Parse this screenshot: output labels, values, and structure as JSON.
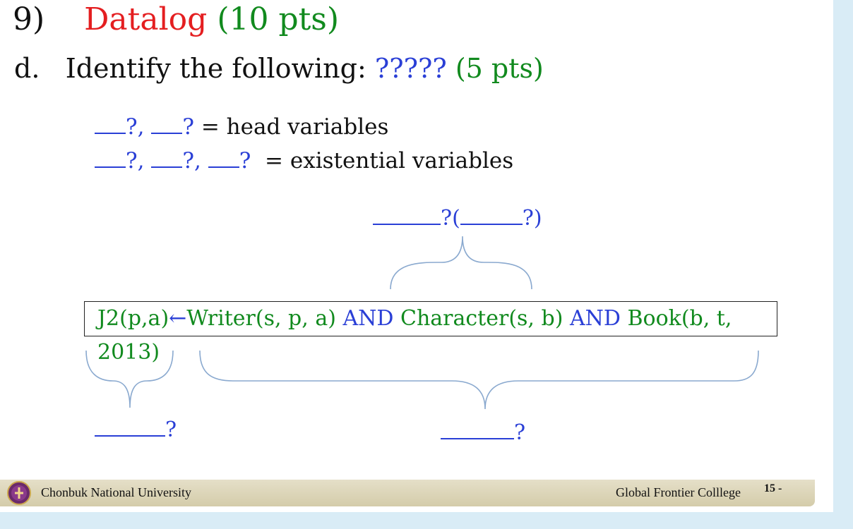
{
  "title": {
    "number": "9)",
    "word": "Datalog",
    "points": "(10 pts)"
  },
  "subtitle": {
    "prefix": "d.",
    "text": "Identify the following:",
    "question": "?????",
    "points": "(5 pts)"
  },
  "variables": {
    "head_label": "= head variables",
    "existential_label": "= existential variables",
    "q": "?",
    "q_comma": "?,"
  },
  "rule": {
    "head": "J2(p,a)",
    "arrow": "←",
    "atom1": "Writer(s, p, a)",
    "and": "AND",
    "atom2": "Character(s, b)",
    "atom3": "Book(b, t, 2013)"
  },
  "top_answer": {
    "q1": "?(",
    "q2": "?)"
  },
  "bottom_left_answer": "?",
  "bottom_right_answer": "?",
  "footer": {
    "left": "Chonbuk  National  University",
    "right": "Global Frontier Colllege",
    "page": "15 -"
  },
  "colors": {
    "title_red": "#e41e20",
    "green": "#118a1e",
    "blue": "#2a3fd6",
    "footer_bg": "#d4ccaa"
  }
}
